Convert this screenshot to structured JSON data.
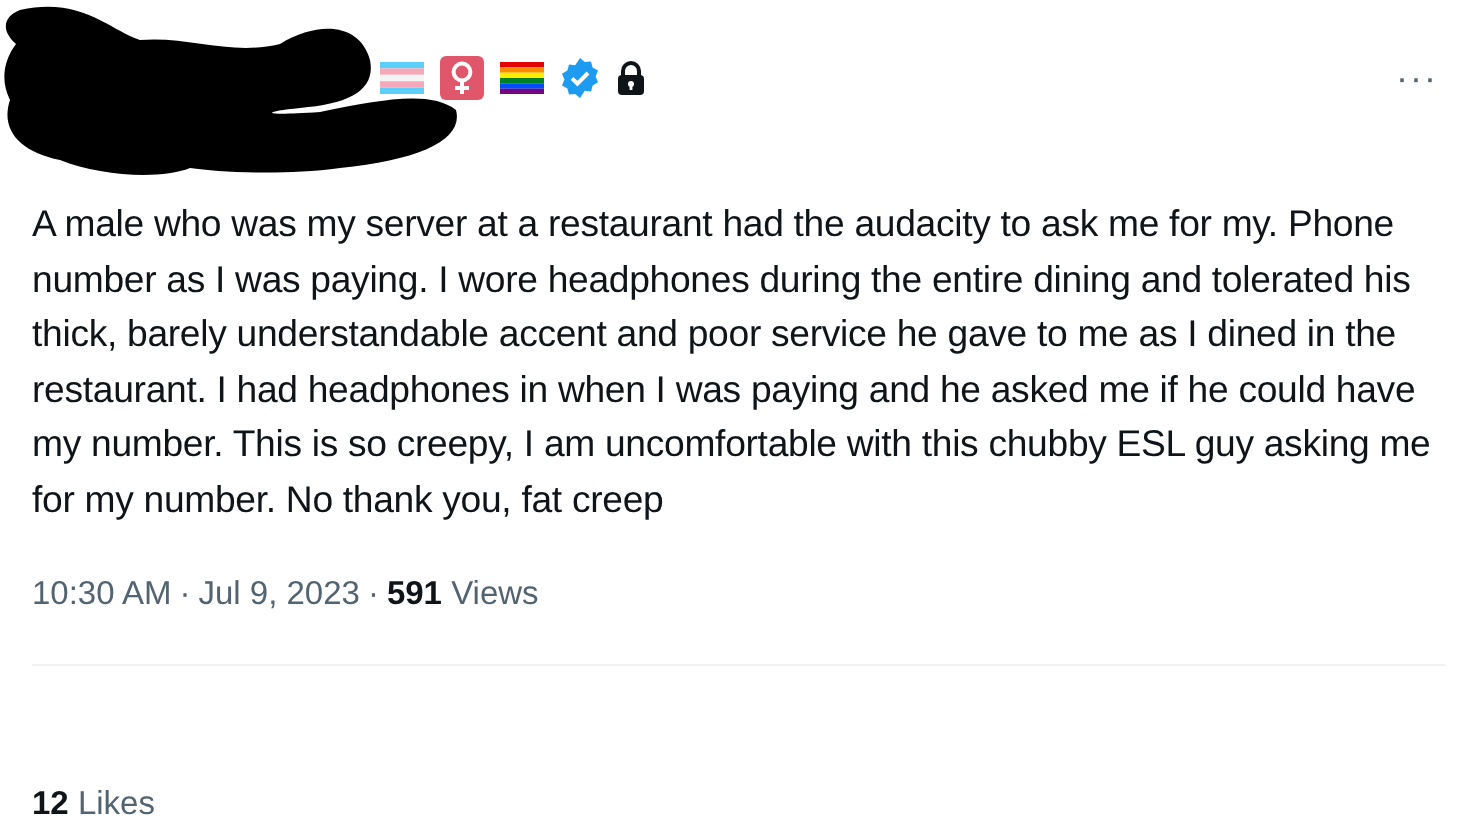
{
  "tweet": {
    "more_button": "···",
    "body": "A male who was my server at a restaurant had the audacity to ask me for my. Phone number as I was paying. I wore headphones during the entire dining and tolerated his thick, barely understandable accent and poor service he gave to me as I dined in the restaurant. I had headphones in when I was paying and he asked me if he could have my number. This is so creepy, I am uncomfortable with this chubby ESL guy asking me for my number. No thank you, fat creep",
    "time": "10:30 AM",
    "separator": "·",
    "date": "Jul 9, 2023",
    "views_count": "591",
    "views_label": "Views",
    "likes_count": "12",
    "likes_label": "Likes"
  }
}
